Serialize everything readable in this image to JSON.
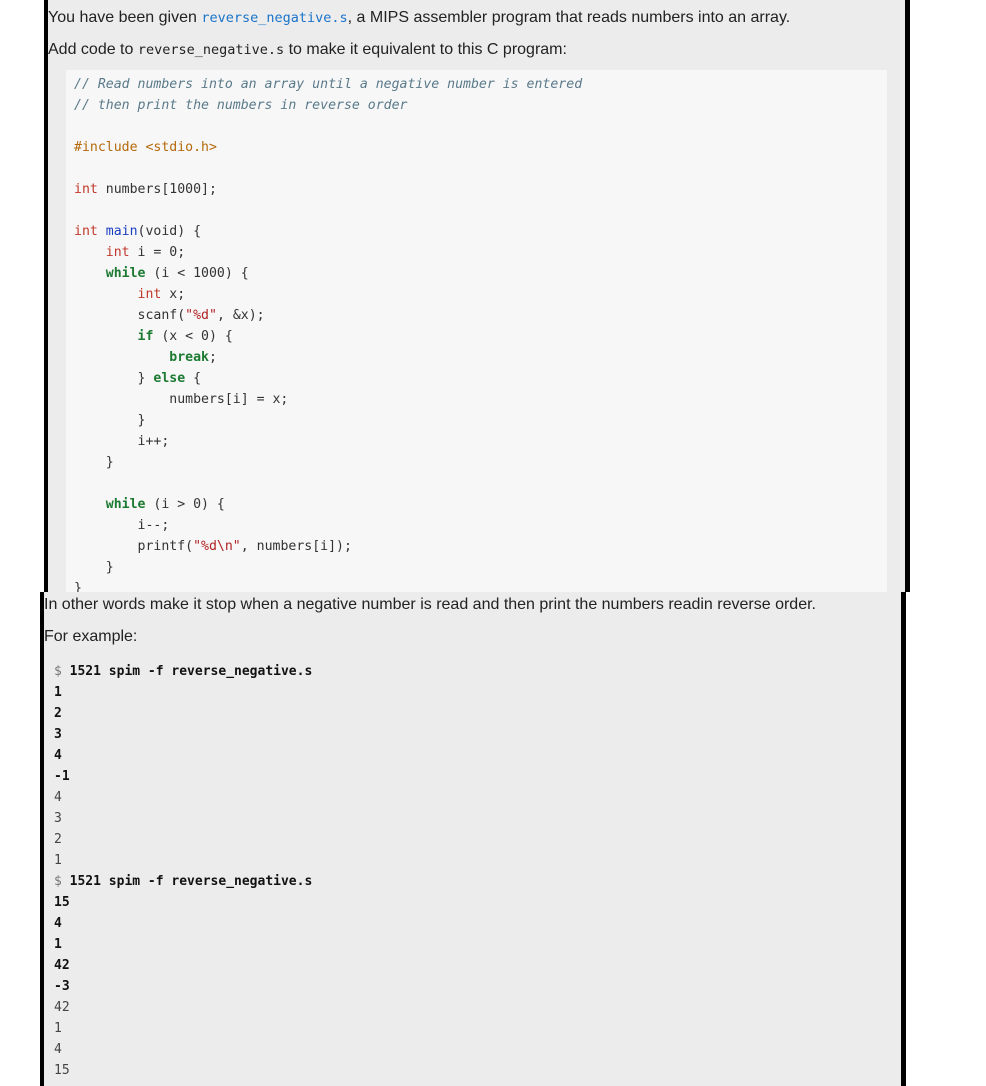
{
  "intro": {
    "line1_pre": "You have been given ",
    "line1_link": "reverse_negative.s",
    "line1_post": ", a MIPS assembler program that reads numbers into an array.",
    "line2_pre": "Add code to ",
    "line2_code": "reverse_negative.s",
    "line2_post": " to make it equivalent to this C program:"
  },
  "c_program": {
    "comment1": "// Read numbers into an array until a negative number is entered",
    "comment2": "// then print the numbers in reverse order",
    "include": "#include <stdio.h>",
    "l_numbers_type": "int",
    "l_numbers_rest": " numbers[1000];",
    "l_main_type": "int",
    "l_main_name": "main",
    "l_main_rest": "(void) {",
    "l_int_i_type": "int",
    "l_int_i_rest": " i = 0;",
    "l_while1_kw": "while",
    "l_while1_rest": " (i < 1000) {",
    "l_int_x_type": "int",
    "l_int_x_rest": " x;",
    "l_scanf_pre": "scanf(",
    "l_scanf_str": "\"%d\"",
    "l_scanf_post": ", &x);",
    "l_if_kw": "if",
    "l_if_rest": " (x < 0) {",
    "l_break": "break",
    "l_break_semi": ";",
    "l_else_pre": "} ",
    "l_else_kw": "else",
    "l_else_post": " {",
    "l_assign": "numbers[i] = x;",
    "l_close_inner": "}",
    "l_incr": "i++;",
    "l_close_while1": "}",
    "l_while2_kw": "while",
    "l_while2_rest": " (i > 0) {",
    "l_decr": "i--;",
    "l_printf_pre": "printf(",
    "l_printf_str": "\"%d\\n\"",
    "l_printf_post": ", numbers[i]);",
    "l_close_while2": "}",
    "l_close_main": "}"
  },
  "explanation": "In other words make it stop when a negative number is read and then print the numbers readin reverse order.",
  "for_example": "For example:",
  "terminal": {
    "prompt": "$",
    "command": "1521 spim -f reverse_negative.s",
    "run1_inputs": [
      "1",
      "2",
      "3",
      "4",
      "-1"
    ],
    "run1_outputs": [
      "4",
      "3",
      "2",
      "1"
    ],
    "run2_inputs": [
      "15",
      "4",
      "1",
      "42",
      "-3"
    ],
    "run2_outputs": [
      "42",
      "1",
      "4",
      "15"
    ]
  }
}
